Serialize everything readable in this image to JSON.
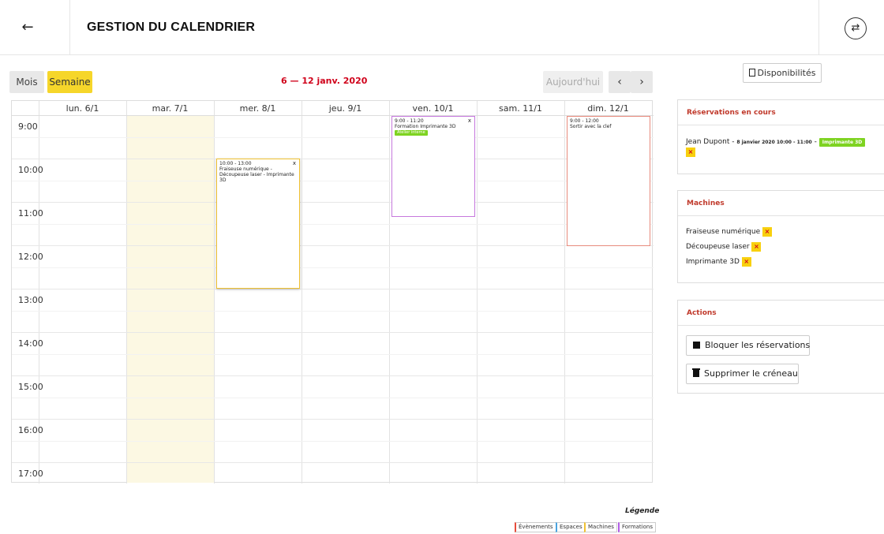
{
  "header": {
    "title": "GESTION DU CALENDRIER",
    "back_icon": "←",
    "swap_icon": "⇄"
  },
  "toolbar": {
    "views": [
      "Mois",
      "Semaine"
    ],
    "date_range": "6 — 12 janv. 2020",
    "today": "Aujourd'hui",
    "prev": "‹",
    "next": "›"
  },
  "calendar": {
    "days": [
      "lun. 6/1",
      "mar. 7/1",
      "mer. 8/1",
      "jeu. 9/1",
      "ven. 10/1",
      "sam. 11/1",
      "dim. 12/1"
    ],
    "times": [
      "9:00",
      "10:00",
      "11:00",
      "12:00",
      "13:00",
      "14:00",
      "15:00",
      "16:00",
      "17:00"
    ],
    "events": [
      {
        "time": "10:00 - 13:00",
        "title": "Fraiseuse numérique - Découpeuse laser - Imprimante 3D",
        "close": "x"
      },
      {
        "time": "9:00 - 11:20",
        "title": "Formation Imprimante 3D",
        "tag": "Atelier interne",
        "close": "x"
      },
      {
        "time": "9:00 - 12:00",
        "title": "Sortir avec la clef"
      }
    ]
  },
  "legend": {
    "title": "Légende",
    "items": [
      "Évènements",
      "Espaces",
      "Machines",
      "Formations"
    ]
  },
  "sidebar": {
    "availability_button": "Disponibilités",
    "reservations": {
      "title": "Réservations en cours",
      "user": "Jean Dupont -",
      "date": "8 janvier 2020 10:00 - 11:00",
      "sep": "-",
      "machine": "Imprimante 3D",
      "remove": "×"
    },
    "machines": {
      "title": "Machines",
      "items": [
        "Fraiseuse numérique",
        "Découpeuse laser",
        "Imprimante 3D"
      ],
      "remove": "×"
    },
    "actions": {
      "title": "Actions",
      "block": "Bloquer les réservations",
      "delete": "Supprimer le créneau"
    }
  },
  "colors": {
    "accent_yellow": "#f6d62a",
    "date_red": "#d0021b",
    "today_bg": "#fcf8e3",
    "tag_green": "#7ed321"
  }
}
